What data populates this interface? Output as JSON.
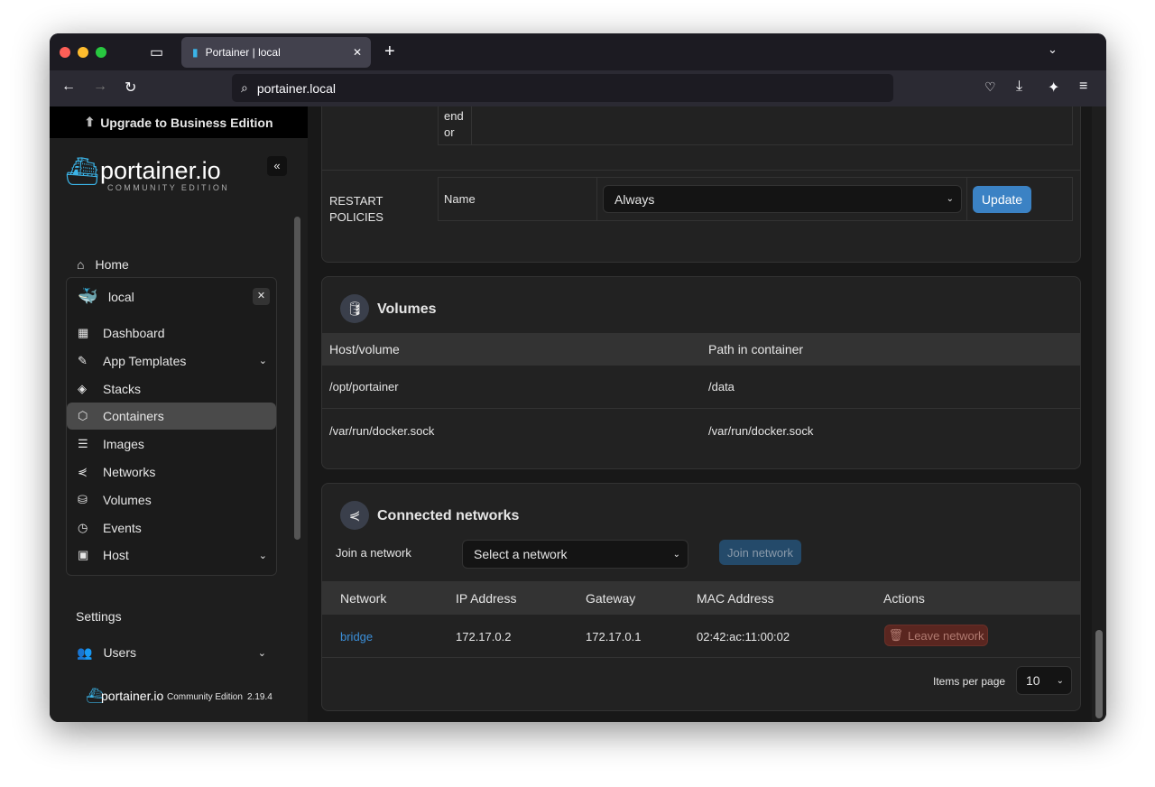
{
  "browser": {
    "tab_title": "Portainer | local",
    "url": "portainer.local"
  },
  "sidebar": {
    "upgrade": "Upgrade to Business Edition",
    "logo": "portainer.io",
    "logo_sub": "COMMUNITY EDITION",
    "home": "Home",
    "env_name": "local",
    "items": [
      {
        "label": "Dashboard",
        "icon": "dashboard-icon"
      },
      {
        "label": "App Templates",
        "icon": "edit-icon",
        "chevron": true
      },
      {
        "label": "Stacks",
        "icon": "layers-icon"
      },
      {
        "label": "Containers",
        "icon": "box-icon",
        "active": true
      },
      {
        "label": "Images",
        "icon": "list-icon"
      },
      {
        "label": "Networks",
        "icon": "share-icon"
      },
      {
        "label": "Volumes",
        "icon": "database-icon"
      },
      {
        "label": "Events",
        "icon": "clock-icon"
      },
      {
        "label": "Host",
        "icon": "host-icon",
        "chevron": true
      }
    ],
    "settings": "Settings",
    "users": "Users",
    "footer_logo": "portainer.io",
    "footer_edition": "Community Edition",
    "footer_version": "2.19.4"
  },
  "top": {
    "fragment_line1": "end",
    "fragment_line2": "or"
  },
  "restart": {
    "label_line1": "RESTART",
    "label_line2": "POLICIES",
    "name_label": "Name",
    "value": "Always",
    "update": "Update"
  },
  "volumes": {
    "title": "Volumes",
    "headers": [
      "Host/volume",
      "Path in container"
    ],
    "rows": [
      [
        "/opt/portainer",
        "/data"
      ],
      [
        "/var/run/docker.sock",
        "/var/run/docker.sock"
      ]
    ]
  },
  "networks": {
    "title": "Connected networks",
    "join_label": "Join a network",
    "select_placeholder": "Select a network",
    "join_button": "Join network",
    "headers": [
      "Network",
      "IP Address",
      "Gateway",
      "MAC Address",
      "Actions"
    ],
    "rows": [
      {
        "network": "bridge",
        "ip": "172.17.0.2",
        "gateway": "172.17.0.1",
        "mac": "02:42:ac:11:00:02",
        "action": "Leave network"
      }
    ],
    "items_per_page_label": "Items per page",
    "items_per_page": "10"
  },
  "colors": {
    "accent": "#3b82c4",
    "danger": "#5a2620",
    "link": "#3b8fd9"
  }
}
